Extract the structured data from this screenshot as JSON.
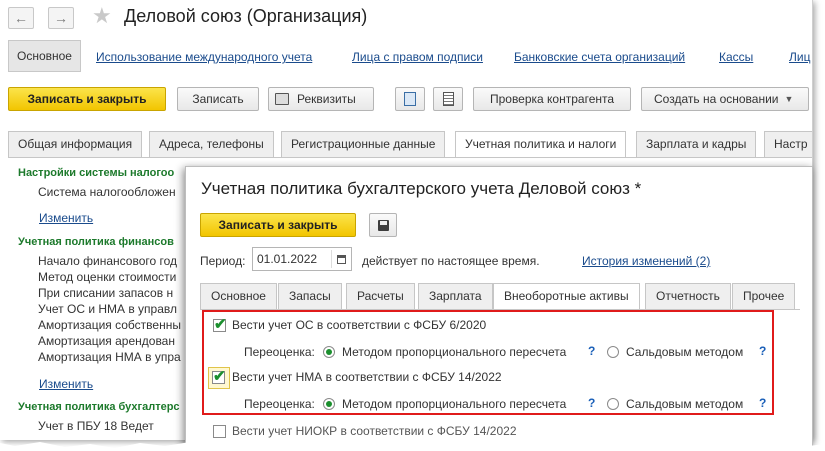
{
  "window": {
    "title": "Деловой союз (Организация)",
    "nav_back_icon": "arrow-left-icon",
    "nav_forward_icon": "arrow-right-icon",
    "star_icon": "star-icon"
  },
  "top_links": {
    "main": "Основное",
    "items": [
      "Использование международного учета",
      "Лица с правом подписи",
      "Банковские счета организаций",
      "Кассы",
      "Лиц"
    ]
  },
  "toolbar": {
    "write_close": "Записать и закрыть",
    "write": "Записать",
    "requisites": "Реквизиты",
    "check_contractor": "Проверка контрагента",
    "create_based": "Создать на основании"
  },
  "tabs": [
    "Общая информация",
    "Адреса, телефоны",
    "Регистрационные данные",
    "Учетная политика и налоги",
    "Зарплата и кадры",
    "Настр"
  ],
  "left_panel": {
    "section1": "Настройки системы налогоо",
    "s1_line1": "Система налогообложен",
    "s1_link": "Изменить",
    "section2": "Учетная политика финансов",
    "s2_lines": [
      "Начало финансового год",
      "Метод оценки стоимости",
      "При списании запасов н",
      "Учет ОС и НМА в управл",
      "Амортизация собственны",
      "Амортизация арендован",
      "Амортизация НМА в упра"
    ],
    "s2_link": "Изменить",
    "section3": "Учетная политика бухгалтерс",
    "s3_line1": "Учет в ПБУ 18 Ведет"
  },
  "dialog": {
    "title": "Учетная политика бухгалтерского учета Деловой союз *",
    "write_close": "Записать и закрыть",
    "period_label": "Период:",
    "period_value": "01.01.2022",
    "valid_text": "действует по настоящее время.",
    "history_link": "История изменений (2)",
    "tabs": [
      "Основное",
      "Запасы",
      "Расчеты",
      "Зарплата",
      "Внеоборотные активы",
      "Отчетность",
      "Прочее"
    ],
    "row1_label": "Вести учет ОС в соответствии с ФСБУ 6/2020",
    "row2_label": "Вести учет НМА в соответствии с ФСБУ 14/2022",
    "row3_label": "Вести учет НИОКР в соответствии с ФСБУ 14/2022",
    "reval_label": "Переоценка:",
    "opt1": "Методом пропорционального пересчета",
    "opt2": "Сальдовым методом",
    "help": "?",
    "highlight_color": "#e01b1b"
  }
}
